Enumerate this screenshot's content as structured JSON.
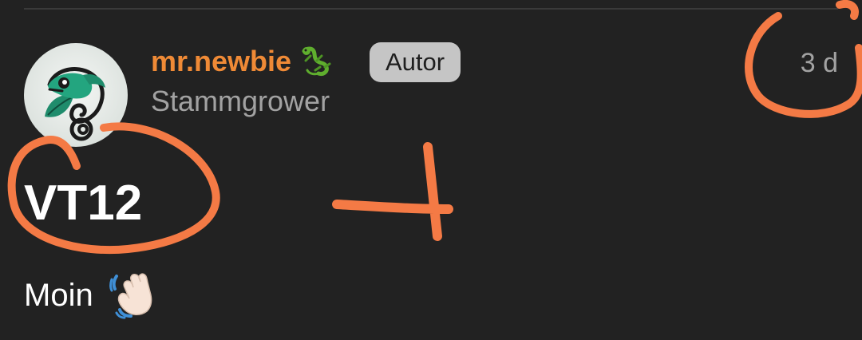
{
  "post": {
    "author": {
      "username": "mr.newbie",
      "username_icon": "lizard-icon",
      "rank": "Stammgrower",
      "badge": "Autor",
      "avatar_icon": "chameleon-avatar"
    },
    "timestamp": "3 d",
    "title": "VT12",
    "body": "Moin",
    "body_icon": "waving-hand-icon"
  },
  "colors": {
    "background": "#222222",
    "username": "#ef8a36",
    "muted_text": "#a2a2a2",
    "badge_bg": "#c5c5c5",
    "annotation": "#f47a45"
  }
}
